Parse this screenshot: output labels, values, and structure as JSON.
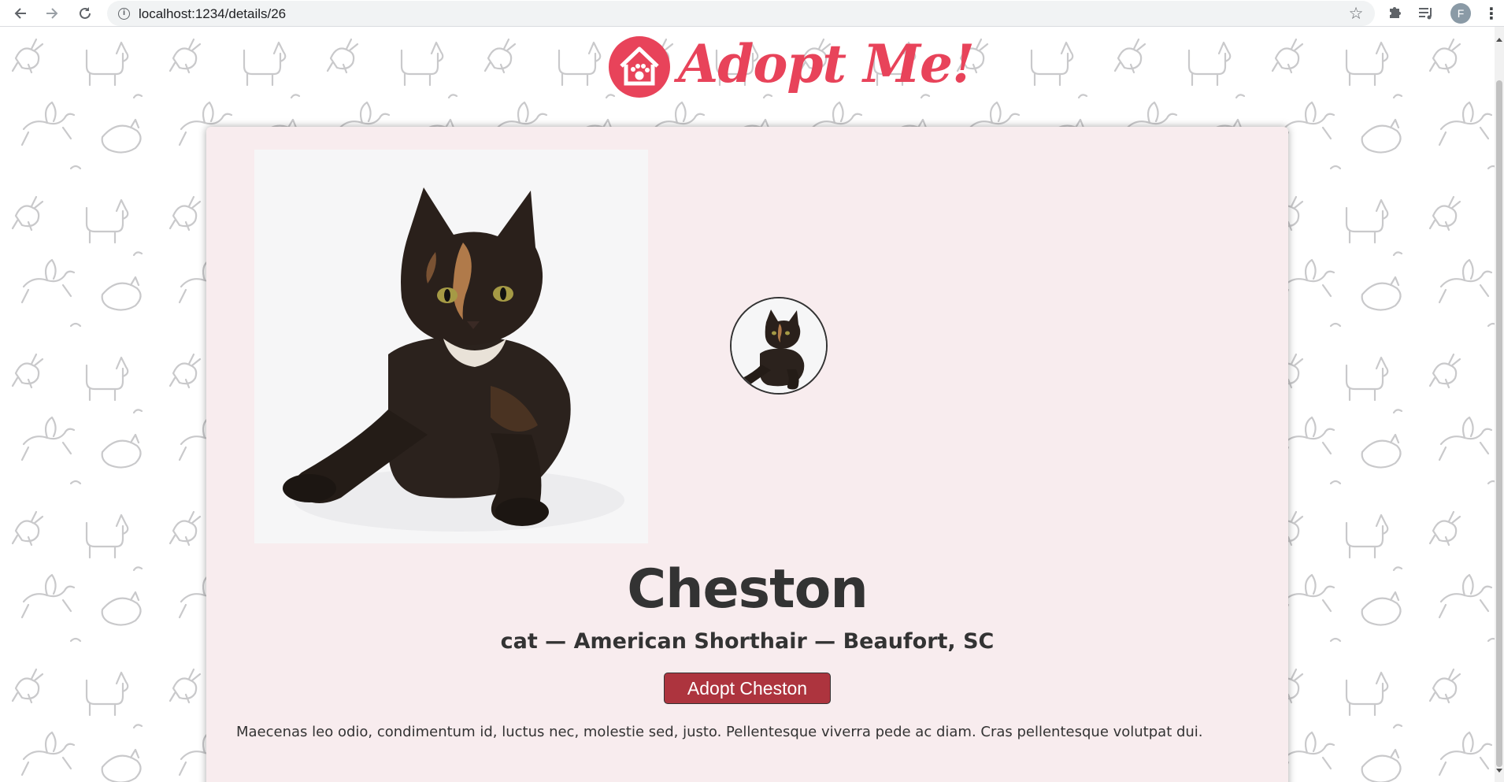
{
  "browser": {
    "url": "localhost:1234/details/26",
    "profile_initial": "F",
    "icons": [
      "back-arrow-icon",
      "forward-arrow-icon",
      "reload-icon",
      "info-icon",
      "star-icon",
      "extensions-puzzle-icon",
      "media-queue-icon",
      "kebab-menu-icon"
    ]
  },
  "header": {
    "logo_text": "Adopt Me!",
    "logo_icon": "house-paw-icon"
  },
  "pet": {
    "name": "Cheston",
    "meta": "cat — American Shorthair — Beaufort, SC",
    "adopt_button": "Adopt Cheston",
    "description": "Maecenas leo odio, condimentum id, luctus nec, molestie sed, justo. Pellentesque viverra pede ac diam. Cras pellentesque volutpat dui."
  },
  "colors": {
    "brand": "#e8435a",
    "button": "#ad343e",
    "card_background": "#f8ecee",
    "text": "#333333"
  }
}
